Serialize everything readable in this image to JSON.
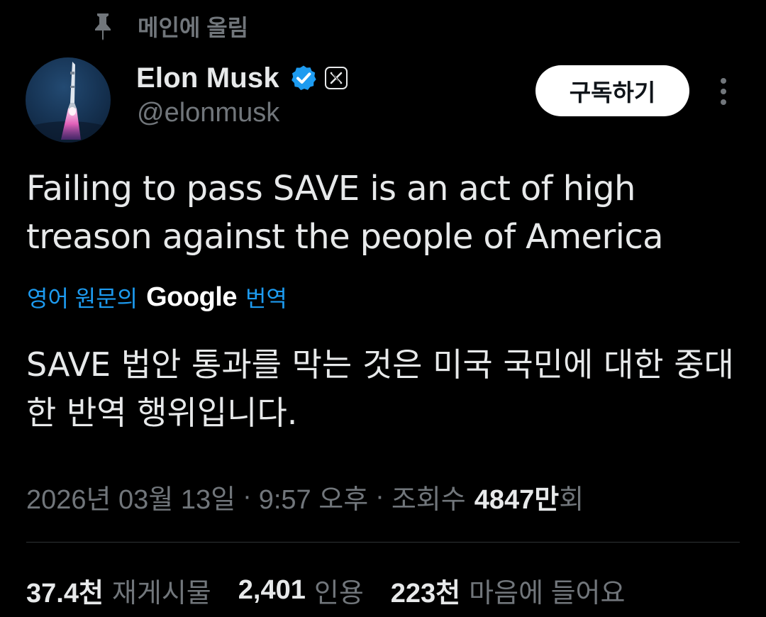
{
  "pinned": {
    "label": "메인에 올림",
    "icon": "pin-icon"
  },
  "author": {
    "display_name": "Elon Musk",
    "handle": "@elonmusk",
    "verified_color": "#1d9bf0",
    "badge_icon": "x-logo-icon",
    "avatar_icon": "rocket-avatar"
  },
  "actions": {
    "subscribe_label": "구독하기",
    "more_icon": "more-vertical-icon"
  },
  "tweet": {
    "text": "Failing to pass SAVE is an act of high treason against the people of America"
  },
  "translation": {
    "prefix": "영어 원문의",
    "brand": "Google",
    "suffix": "번역",
    "text": "SAVE 법안 통과를 막는 것은 미국 국민에 대한 중대한 반역 행위입니다."
  },
  "meta": {
    "date": "2026년 03월 13일",
    "separator": "·",
    "time": "9:57 오후",
    "views_label": "조회수",
    "views_count": "4847만",
    "views_suffix": "회"
  },
  "stats": {
    "reposts_count": "37.4천",
    "reposts_label": "재게시물",
    "quotes_count": "2,401",
    "quotes_label": "인용",
    "likes_count": "223천",
    "likes_label": "마음에 들어요"
  },
  "colors": {
    "background": "#000000",
    "text": "#e7e9ea",
    "muted": "#71767b",
    "accent": "#1d9bf0"
  }
}
